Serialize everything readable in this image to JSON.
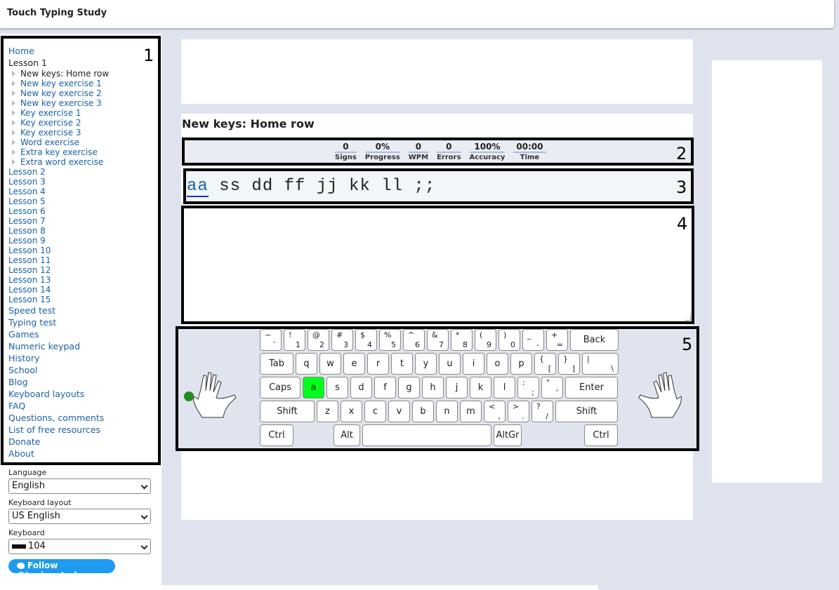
{
  "app": {
    "title": "Touch Typing Study"
  },
  "nav": {
    "home": "Home",
    "lesson1": "Lesson 1",
    "lesson1_items": [
      "New keys: Home row",
      "New key exercise 1",
      "New key exercise 2",
      "New key exercise 3",
      "Key exercise 1",
      "Key exercise 2",
      "Key exercise 3",
      "Word exercise",
      "Extra key exercise",
      "Extra word exercise"
    ],
    "lessons": [
      "Lesson 2",
      "Lesson 3",
      "Lesson 4",
      "Lesson 5",
      "Lesson 6",
      "Lesson 7",
      "Lesson 8",
      "Lesson 9",
      "Lesson 10",
      "Lesson 11",
      "Lesson 12",
      "Lesson 13",
      "Lesson 14",
      "Lesson 15"
    ],
    "bottom": [
      "Speed test",
      "Typing test",
      "Games",
      "Numeric keypad",
      "History",
      "School",
      "Blog",
      "Keyboard layouts",
      "FAQ",
      "Questions, comments",
      "List of free resources",
      "Donate",
      "About"
    ]
  },
  "annotations": [
    "1",
    "2",
    "3",
    "4",
    "5"
  ],
  "settings": {
    "language_label": "Language",
    "language_value": "English",
    "layout_label": "Keyboard layout",
    "layout_value": "US English",
    "keyboard_label": "Keyboard",
    "keyboard_value": "104"
  },
  "twitter": {
    "label": "Follow @typingstudy"
  },
  "page": {
    "title": "New keys: Home row"
  },
  "stats": [
    {
      "value": "0",
      "label": "Signs"
    },
    {
      "value": "0%",
      "label": "Progress"
    },
    {
      "value": "0",
      "label": "WPM"
    },
    {
      "value": "0",
      "label": "Errors"
    },
    {
      "value": "100%",
      "label": "Accuracy"
    },
    {
      "value": "00:00",
      "label": "Time"
    }
  ],
  "exercise": {
    "current": "aa",
    "rest": " ss dd ff jj kk ll ;;"
  },
  "keyboard": {
    "row1": [
      [
        "~",
        "`"
      ],
      [
        "!",
        "1"
      ],
      [
        "@",
        "2"
      ],
      [
        "#",
        "3"
      ],
      [
        "$",
        "4"
      ],
      [
        "%",
        "5"
      ],
      [
        "^",
        "6"
      ],
      [
        "&",
        "7"
      ],
      [
        "*",
        "8"
      ],
      [
        "(",
        "9"
      ],
      [
        ")",
        "0"
      ],
      [
        "_",
        "-"
      ],
      [
        "+",
        "="
      ]
    ],
    "row1_back": "Back",
    "row2_tab": "Tab",
    "row2": [
      "q",
      "w",
      "e",
      "r",
      "t",
      "y",
      "u",
      "i",
      "o",
      "p"
    ],
    "row2_sym": [
      [
        "{",
        "["
      ],
      [
        "}",
        "]"
      ]
    ],
    "row2_pipe": [
      "|",
      "\\"
    ],
    "row3_caps": "Caps",
    "row3": [
      "a",
      "s",
      "d",
      "f",
      "g",
      "h",
      "j",
      "k",
      "l"
    ],
    "row3_sym": [
      [
        ":",
        ";"
      ],
      [
        "\"",
        "'"
      ]
    ],
    "row3_enter": "Enter",
    "row4_shift": "Shift",
    "row4": [
      "z",
      "x",
      "c",
      "v",
      "b",
      "n",
      "m"
    ],
    "row4_sym": [
      [
        "<",
        ","
      ],
      [
        ">",
        "."
      ],
      [
        "?",
        "/"
      ]
    ],
    "row5": [
      "Ctrl",
      "Alt",
      "AltGr",
      "Ctrl"
    ],
    "active_key": "a",
    "active_color": "#00ff1a"
  }
}
